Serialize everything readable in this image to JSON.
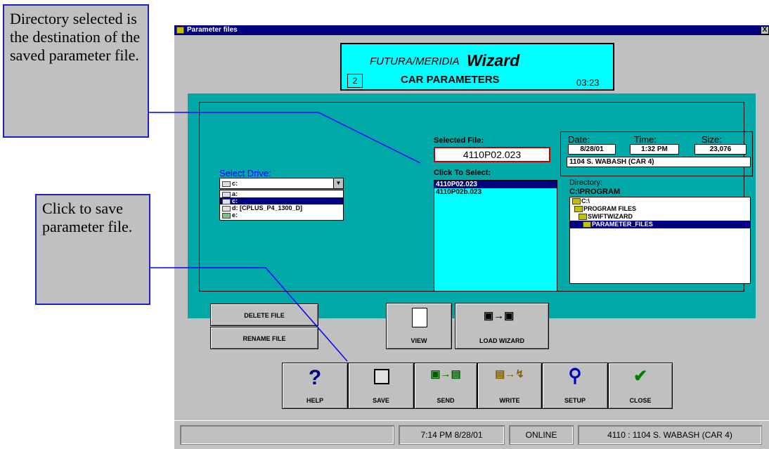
{
  "window": {
    "title": "Parameter files",
    "close_glyph": "X"
  },
  "wizard": {
    "brand": "FUTURA/MERIDIA",
    "title": "Wizard",
    "step": "2",
    "subtitle": "CAR PARAMETERS",
    "time": "03:23"
  },
  "drive": {
    "label": "Select Drive:",
    "current": "c:",
    "options": [
      "a:",
      "c:",
      "d: [CPLUS_P4_1300_D]",
      "e:"
    ],
    "selected_index": 1
  },
  "file": {
    "selected_label": "Selected File:",
    "selected_value": "4110P02.023",
    "list_label": "Click To Select:",
    "items": [
      "4110P02.023",
      "4110P02b.023"
    ],
    "selected_index": 0
  },
  "info": {
    "date_label": "Date:",
    "time_label": "Time:",
    "size_label": "Size:",
    "date": "8/28/01",
    "time": "1:32 PM",
    "size": "23,076",
    "description": "1104 S. WABASH (CAR 4)"
  },
  "directory": {
    "label": "Directory:",
    "path": "C:\\PROGRAM",
    "items": [
      "C:\\",
      "PROGRAM FILES",
      "SWIFTWIZARD",
      "PARAMETER_FILES"
    ],
    "selected_index": 3
  },
  "buttons": {
    "delete": "DELETE FILE",
    "rename": "RENAME FILE",
    "view": "VIEW",
    "load_wizard": "LOAD WIZARD",
    "help": "HELP",
    "save": "SAVE",
    "send": "SEND",
    "write": "WRITE",
    "setup": "SETUP",
    "close": "CLOSE"
  },
  "icons": {
    "help": "question-icon",
    "save": "floppy-icon",
    "send": "send-icon",
    "write": "write-icon",
    "setup": "wrench-icon",
    "close": "checkmark-icon",
    "view": "document-icon",
    "load_wizard": "load-icon"
  },
  "status": {
    "blank": "",
    "datetime": "7:14 PM 8/28/01",
    "connection": "ONLINE",
    "car": "4110 : 1104 S. WABASH (CAR 4)"
  },
  "callouts": {
    "directory": "Directory selected is the destination of the saved parameter file.",
    "save": "Click to save parameter file."
  },
  "colors": {
    "teal": "#00a8a8",
    "cyan": "#00ffff",
    "navy": "#000080",
    "callout_border": "#2020c0"
  }
}
